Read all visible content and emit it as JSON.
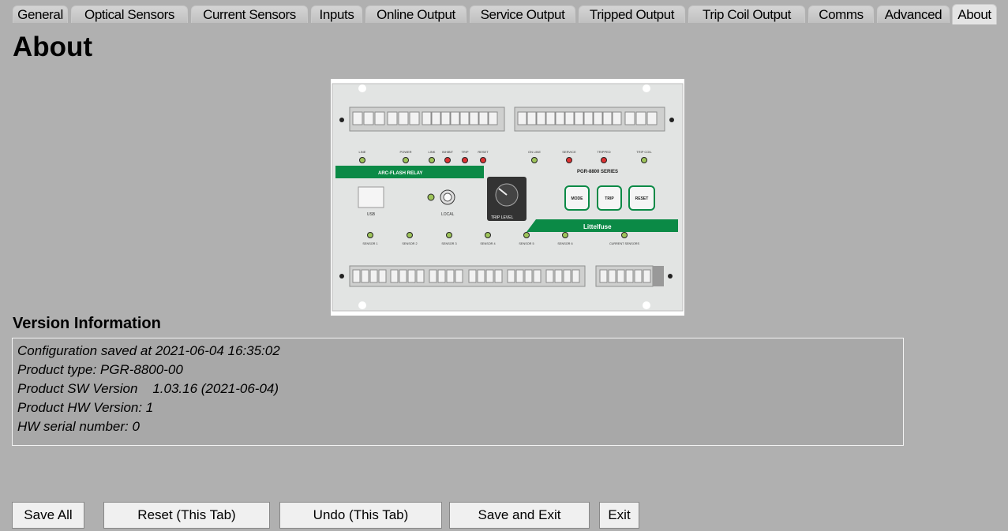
{
  "tabs": [
    {
      "label": "General"
    },
    {
      "label": "Optical Sensors"
    },
    {
      "label": "Current Sensors"
    },
    {
      "label": "Inputs"
    },
    {
      "label": "Online Output"
    },
    {
      "label": "Service Output"
    },
    {
      "label": "Tripped Output"
    },
    {
      "label": "Trip Coil Output"
    },
    {
      "label": "Comms"
    },
    {
      "label": "Advanced"
    },
    {
      "label": "About"
    }
  ],
  "page": {
    "title": "About"
  },
  "device_image": {
    "description": "arc-flash-relay-front-panel",
    "brand_stripe_color": "#0b8a46",
    "labels": {
      "arc_flash_relay": "ARC-FLASH RELAY",
      "series": "PGR-8800 SERIES",
      "trip_level": "TRIP LEVEL",
      "brand": "Littelfuse",
      "usb": "USB",
      "local": "LOCAL",
      "mode_btn": "MODE",
      "trip_btn": "TRIP",
      "reset_btn": "RESET",
      "current_sensors": "CURRENT SENSORS",
      "led_labels": [
        "LINE",
        "POWER",
        "LINK",
        "INHIBIT",
        "TRIP",
        "RESET",
        "ON LINE",
        "SERVICE",
        "TRIPPED",
        "TRIP COIL"
      ],
      "sensors": [
        "SENSOR 1",
        "SENSOR 2",
        "SENSOR 3",
        "SENSOR 4",
        "SENSOR 5",
        "SENSOR 6"
      ]
    }
  },
  "version": {
    "title": "Version Information",
    "lines": [
      "Configuration saved at 2021-06-04 16:35:02",
      "Product type: PGR-8800-00",
      "Product SW Version    1.03.16 (2021-06-04)",
      "Product HW Version: 1",
      "HW serial number: 0"
    ]
  },
  "buttons": {
    "save_all": "Save All",
    "reset_tab": "Reset (This Tab)",
    "undo_tab": "Undo (This Tab)",
    "save_exit": "Save and Exit",
    "exit": "Exit"
  }
}
